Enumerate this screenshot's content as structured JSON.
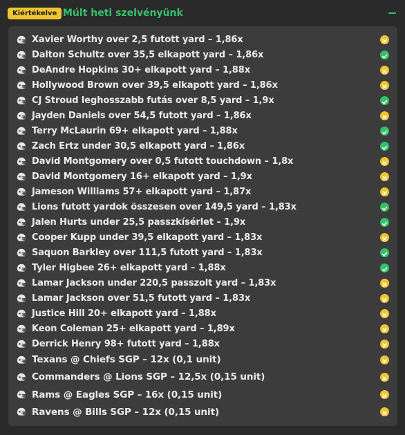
{
  "header": {
    "badge": "Kiértékelve",
    "title": "Múlt heti szelvényünk"
  },
  "colors": {
    "accent_green": "#35c16c",
    "badge_yellow": "#f0c531",
    "panel_bg": "#3c3c3c"
  },
  "bets": [
    {
      "text": "Xavier Worthy over 2,5 futott yard – 1,86x",
      "status": "loss"
    },
    {
      "text": "Dalton Schultz over 35,5 elkapott yard – 1,86x",
      "status": "win"
    },
    {
      "text": "DeAndre Hopkins 30+ elkapott yard – 1,88x",
      "status": "loss"
    },
    {
      "text": "Hollywood Brown over 39,5 elkapott yard – 1,86x",
      "status": "loss"
    },
    {
      "text": "CJ Stroud leghosszabb futás over 8,5 yard – 1,9x",
      "status": "win"
    },
    {
      "text": "Jayden Daniels over 54,5 futott yard – 1,86x",
      "status": "loss"
    },
    {
      "text": "Terry McLaurin 69+ elkapott yard – 1,88x",
      "status": "win"
    },
    {
      "text": "Zach Ertz under 30,5 elkapott yard – 1,86x",
      "status": "win"
    },
    {
      "text": "David Montgomery over 0,5 futott touchdown – 1,8x",
      "status": "loss"
    },
    {
      "text": "David Montgomery 16+ elkapott yard – 1,9x",
      "status": "loss"
    },
    {
      "text": "Jameson Williams 57+ elkapott yard – 1,87x",
      "status": "loss"
    },
    {
      "text": "Lions futott yardok összesen over 149,5 yard – 1,83x",
      "status": "win"
    },
    {
      "text": "Jalen Hurts under 25,5 passzkísérlet – 1,9x",
      "status": "win"
    },
    {
      "text": "Cooper Kupp under 39,5 elkapott yard – 1,83x",
      "status": "loss"
    },
    {
      "text": "Saquon Barkley over 111,5 futott yard – 1,83x",
      "status": "win"
    },
    {
      "text": "Tyler Higbee 26+ elkapott yard – 1,88x",
      "status": "win"
    },
    {
      "text": "Lamar Jackson under 220,5 passzolt yard – 1,83x",
      "status": "loss"
    },
    {
      "text": "Lamar Jackson over 51,5 futott yard – 1,83x",
      "status": "loss"
    },
    {
      "text": "Justice Hill 20+ elkapott yard – 1,88x",
      "status": "loss"
    },
    {
      "text": "Keon Coleman 25+ elkapott yard – 1,89x",
      "status": "loss"
    },
    {
      "text": "Derrick Henry 98+ futott yard – 1,88x",
      "status": "loss"
    },
    {
      "text": "Texans @ Chiefs SGP – 12x (0,1 unit)",
      "status": "loss"
    },
    {
      "text": "Commanders @ Lions SGP – 12,5x (0,15 unit)",
      "status": "loss"
    },
    {
      "text": "Rams @ Eagles SGP – 16x (0,15 unit)",
      "status": "loss"
    },
    {
      "text": "Ravens @ Bills SGP – 12x (0,15 unit)",
      "status": "loss"
    }
  ]
}
